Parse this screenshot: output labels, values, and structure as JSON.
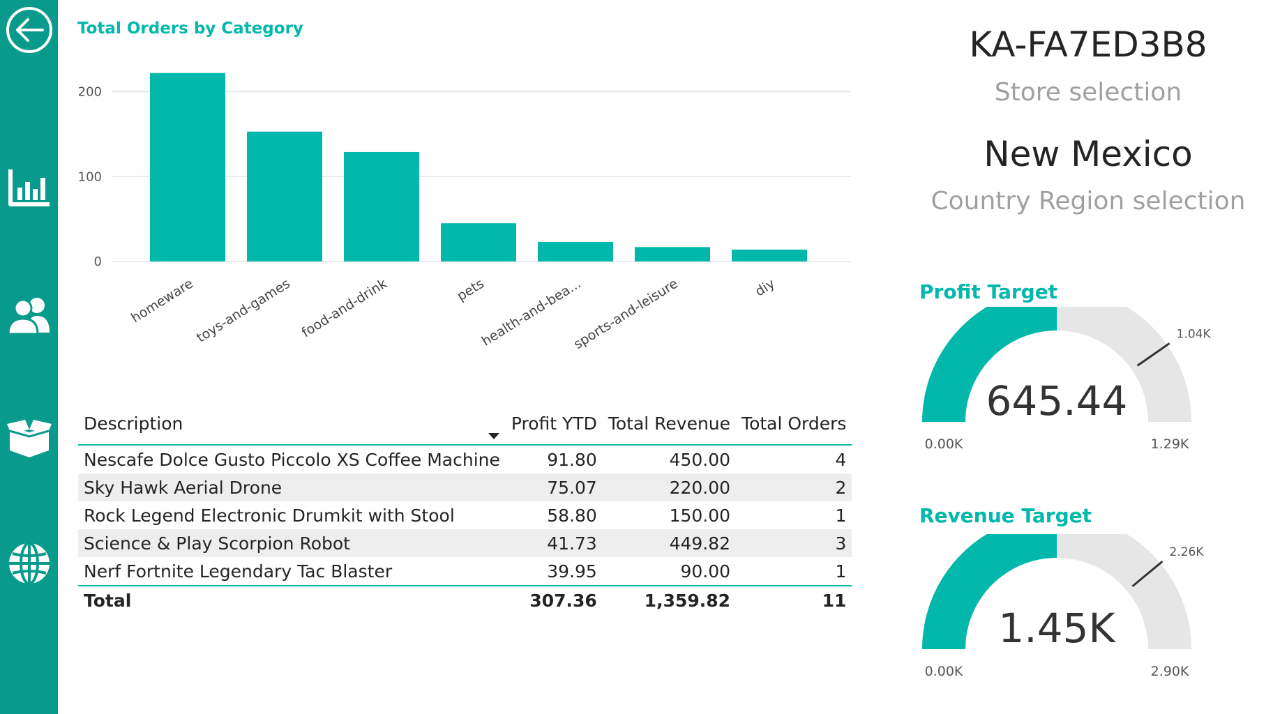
{
  "sidebar": {
    "items": [
      {
        "name": "back",
        "icon": "back-arrow-icon"
      },
      {
        "name": "chart",
        "icon": "bar-chart-icon"
      },
      {
        "name": "people",
        "icon": "people-icon"
      },
      {
        "name": "box",
        "icon": "box-icon"
      },
      {
        "name": "globe",
        "icon": "globe-icon"
      }
    ]
  },
  "colors": {
    "accent": "#01b8aa",
    "sidebar": "#089b8b",
    "track": "#e6e6e6"
  },
  "chart_title": "Total Orders by Category",
  "chart_data": {
    "type": "bar",
    "title": "Total Orders by Category",
    "categories": [
      "homeware",
      "toys-and-games",
      "food-and-drink",
      "pets",
      "health-and-bea...",
      "sports-and-leisure",
      "diy"
    ],
    "values": [
      222,
      153,
      129,
      45,
      23,
      17,
      14
    ],
    "y_ticks": [
      "0",
      "100",
      "200"
    ],
    "ylim": [
      0,
      230
    ],
    "grid": true,
    "xlabel": "",
    "ylabel": ""
  },
  "table": {
    "headers": [
      "Description",
      "Profit YTD",
      "Total Revenue",
      "Total Orders"
    ],
    "rows": [
      [
        "Nescafe Dolce Gusto Piccolo XS Coffee Machine",
        "91.80",
        "450.00",
        "4"
      ],
      [
        "Sky Hawk Aerial Drone",
        "75.07",
        "220.00",
        "2"
      ],
      [
        "Rock Legend Electronic Drumkit with Stool",
        "58.80",
        "150.00",
        "1"
      ],
      [
        "Science & Play Scorpion Robot",
        "41.73",
        "449.82",
        "3"
      ],
      [
        "Nerf Fortnite Legendary Tac Blaster",
        "39.95",
        "90.00",
        "1"
      ]
    ],
    "total": [
      "Total",
      "307.36",
      "1,359.82",
      "11"
    ]
  },
  "store": {
    "value": "KA-FA7ED3B8",
    "label": "Store selection"
  },
  "country": {
    "value": "New Mexico",
    "label": "Country Region selection"
  },
  "profit_gauge": {
    "title": "Profit Target",
    "value_text": "645.44",
    "min_text": "0.00K",
    "max_text": "1.29K",
    "target_text": "1.04K",
    "value": 645.44,
    "min": 0,
    "max": 1290,
    "target": 1040
  },
  "revenue_gauge": {
    "title": "Revenue Target",
    "value_text": "1.45K",
    "min_text": "0.00K",
    "max_text": "2.90K",
    "target_text": "2.26K",
    "value": 1450,
    "min": 0,
    "max": 2900,
    "target": 2260
  }
}
